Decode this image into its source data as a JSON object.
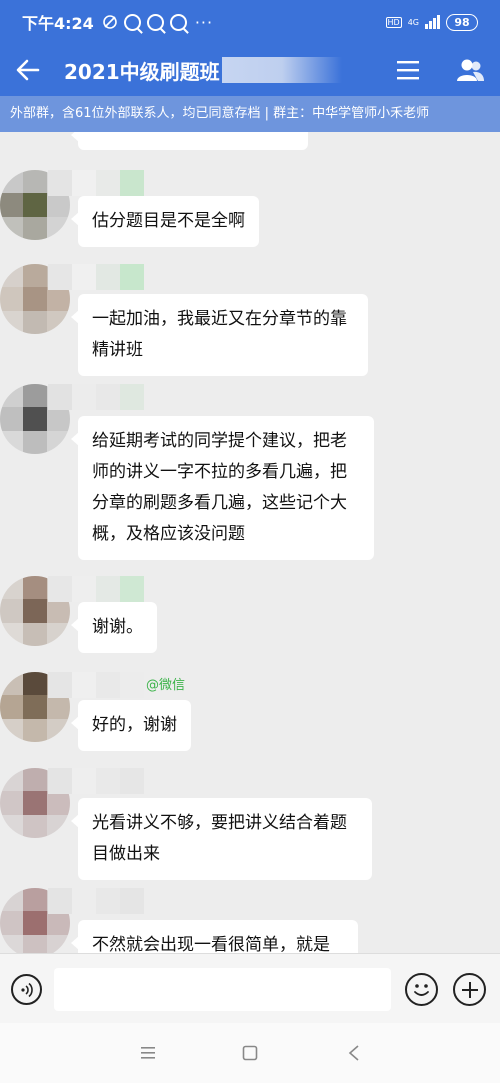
{
  "status_bar": {
    "time": "下午4:24",
    "dots": "···",
    "hd_label": "HD",
    "network_label": "4G",
    "battery": "98"
  },
  "nav": {
    "title": "2021中级刷题班"
  },
  "subtitle": "外部群，含61位外部联系人，均已同意存档 | 群主：中华学管师小禾老师",
  "messages": [
    {
      "name": "",
      "text": "估分题目是不是全啊"
    },
    {
      "name": "",
      "text": "一起加油，我最近又在分章节的靠精讲班"
    },
    {
      "name": "",
      "text": "给延期考试的同学提个建议，把老师的讲义一字不拉的多看几遍，把分章的刷题多看几遍，这些记个大概，及格应该没问题"
    },
    {
      "name": "",
      "text": "谢谢。"
    },
    {
      "name": "@微信",
      "text": "好的，谢谢"
    },
    {
      "name": "",
      "text": "光看讲义不够，要把讲义结合着题目做出来"
    },
    {
      "name": "",
      "text": "不然就会出现一看很简单，就是"
    }
  ],
  "input": {
    "value": "",
    "placeholder": ""
  },
  "icons": {
    "back": "arrow-left-icon",
    "menu": "menu-icon",
    "members": "group-members-icon",
    "voice": "voice-icon",
    "emoji": "emoji-icon",
    "plus": "plus-icon",
    "sys_menu": "recent-apps-icon",
    "sys_home": "home-icon",
    "sys_back": "back-triangle-icon"
  },
  "colors": {
    "header": "#3b72d9",
    "subbar": "#6e95dd",
    "chat_bg": "#ededed",
    "name_green": "#3cb34a"
  }
}
